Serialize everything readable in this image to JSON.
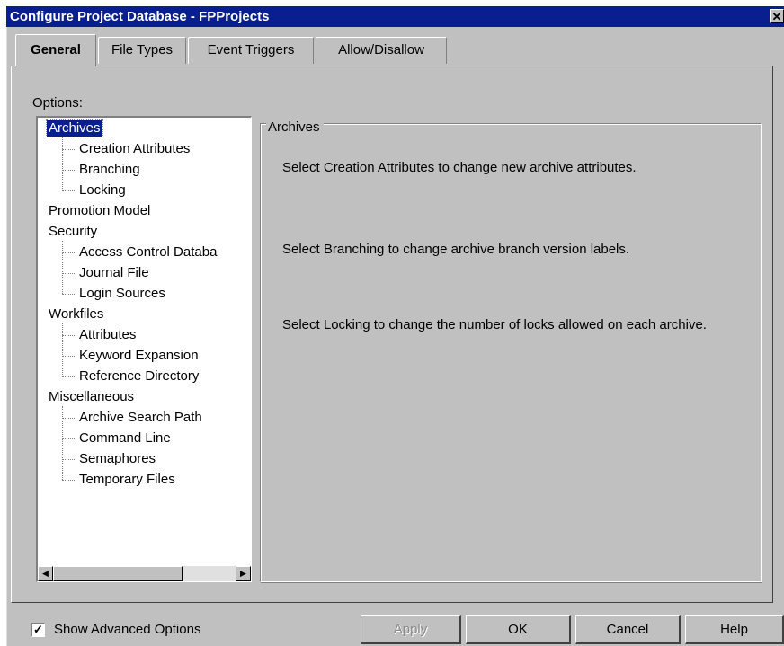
{
  "window": {
    "title": "Configure Project Database - FPProjects",
    "close_glyph": "✕"
  },
  "tabs": [
    {
      "label": "General",
      "active": true
    },
    {
      "label": "File Types",
      "active": false
    },
    {
      "label": "Event Triggers",
      "active": false
    },
    {
      "label": "Allow/Disallow",
      "active": false
    }
  ],
  "options_label": "Options:",
  "tree": [
    {
      "label": "Archives",
      "level": 0,
      "selected": true
    },
    {
      "label": "Creation Attributes",
      "level": 1
    },
    {
      "label": "Branching",
      "level": 1
    },
    {
      "label": "Locking",
      "level": 1
    },
    {
      "label": "Promotion Model",
      "level": 0
    },
    {
      "label": "Security",
      "level": 0
    },
    {
      "label": "Access Control Databa",
      "level": 1
    },
    {
      "label": "Journal File",
      "level": 1
    },
    {
      "label": "Login Sources",
      "level": 1
    },
    {
      "label": "Workfiles",
      "level": 0
    },
    {
      "label": "Attributes",
      "level": 1
    },
    {
      "label": "Keyword Expansion",
      "level": 1
    },
    {
      "label": "Reference Directory",
      "level": 1
    },
    {
      "label": "Miscellaneous",
      "level": 0
    },
    {
      "label": "Archive Search Path",
      "level": 1
    },
    {
      "label": "Command Line",
      "level": 1
    },
    {
      "label": "Semaphores",
      "level": 1
    },
    {
      "label": "Temporary Files",
      "level": 1
    }
  ],
  "group": {
    "title": "Archives",
    "descriptions": [
      "Select Creation Attributes to change new archive attributes.",
      "Select Branching to change archive branch version labels.",
      "Select Locking to change the number of locks allowed on each archive."
    ]
  },
  "advanced": {
    "label": "Show Advanced Options",
    "checked": true,
    "check_glyph": "✓"
  },
  "buttons": {
    "apply": "Apply",
    "ok": "OK",
    "cancel": "Cancel",
    "help": "Help"
  },
  "scroll": {
    "left_arrow": "◀",
    "right_arrow": "▶"
  }
}
